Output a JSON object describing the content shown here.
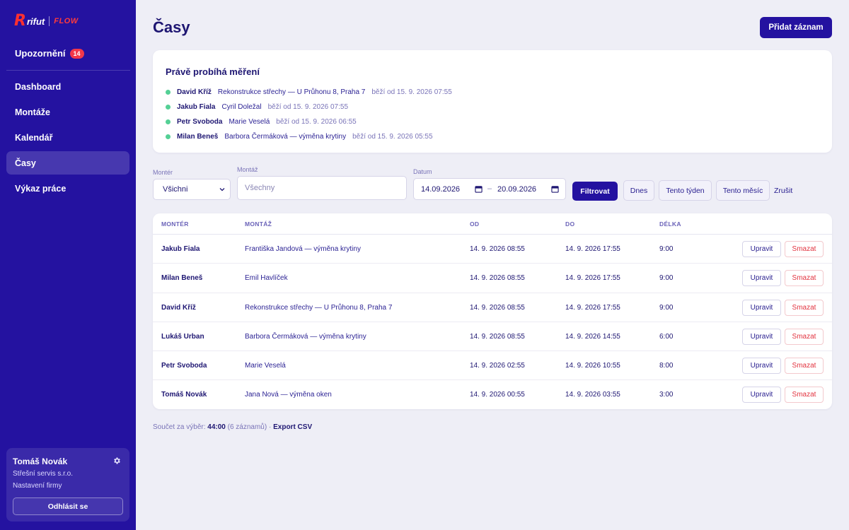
{
  "brand": {
    "logo_letter": "R",
    "logo_name": "rifut",
    "logo_product": "FLOW"
  },
  "sidebar": {
    "notifications_label": "Upozornění",
    "notifications_count": "14",
    "items": [
      {
        "label": "Dashboard",
        "active": false
      },
      {
        "label": "Montáže",
        "active": false
      },
      {
        "label": "Kalendář",
        "active": false
      },
      {
        "label": "Časy",
        "active": true
      },
      {
        "label": "Výkaz práce",
        "active": false
      }
    ],
    "user": {
      "name": "Tomáš Novák",
      "company": "Střešní servis s.r.o.",
      "settings_label": "Nastavení firmy",
      "logout_label": "Odhlásit se"
    }
  },
  "header": {
    "title": "Časy",
    "add_button": "Přidat záznam"
  },
  "running": {
    "title": "Právě probíhá měření",
    "items": [
      {
        "worker": "David Kříž",
        "job": "Rekonstrukce střechy — U Průhonu 8, Praha 7",
        "since": "běží od 15. 9. 2026 07:55"
      },
      {
        "worker": "Jakub Fiala",
        "job": "Cyril Doležal",
        "since": "běží od 15. 9. 2026 07:55"
      },
      {
        "worker": "Petr Svoboda",
        "job": "Marie Veselá",
        "since": "běží od 15. 9. 2026 06:55"
      },
      {
        "worker": "Milan Beneš",
        "job": "Barbora Čermáková — výměna krytiny",
        "since": "běží od 15. 9. 2026 05:55"
      }
    ]
  },
  "filters": {
    "worker_label": "Montér",
    "worker_value": "Všichni",
    "job_label": "Montáž",
    "job_placeholder": "Všechny",
    "date_label": "Datum",
    "date_from": "14.09.2026",
    "date_sep": "–",
    "date_to": "20.09.2026",
    "filter_button": "Filtrovat",
    "today_button": "Dnes",
    "week_button": "Tento týden",
    "month_button": "Tento měsíc",
    "reset_link": "Zrušit"
  },
  "table": {
    "headers": {
      "worker": "MONTÉR",
      "job": "MONTÁŽ",
      "from": "OD",
      "to": "DO",
      "duration": "DÉLKA"
    },
    "edit_label": "Upravit",
    "delete_label": "Smazat",
    "rows": [
      {
        "worker": "Jakub Fiala",
        "job": "Františka Jandová — výměna krytiny",
        "from": "14. 9. 2026 08:55",
        "to": "14. 9. 2026 17:55",
        "duration": "9:00"
      },
      {
        "worker": "Milan Beneš",
        "job": "Emil Havlíček",
        "from": "14. 9. 2026 08:55",
        "to": "14. 9. 2026 17:55",
        "duration": "9:00"
      },
      {
        "worker": "David Kříž",
        "job": "Rekonstrukce střechy — U Průhonu 8, Praha 7",
        "from": "14. 9. 2026 08:55",
        "to": "14. 9. 2026 17:55",
        "duration": "9:00"
      },
      {
        "worker": "Lukáš Urban",
        "job": "Barbora Čermáková — výměna krytiny",
        "from": "14. 9. 2026 08:55",
        "to": "14. 9. 2026 14:55",
        "duration": "6:00"
      },
      {
        "worker": "Petr Svoboda",
        "job": "Marie Veselá",
        "from": "14. 9. 2026 02:55",
        "to": "14. 9. 2026 10:55",
        "duration": "8:00"
      },
      {
        "worker": "Tomáš Novák",
        "job": "Jana Nová — výměna oken",
        "from": "14. 9. 2026 00:55",
        "to": "14. 9. 2026 03:55",
        "duration": "3:00"
      }
    ]
  },
  "summary": {
    "prefix": "Součet za výběr:",
    "total": "44:00",
    "count": "(6 záznamů)",
    "separator": "·",
    "export_link": "Export CSV"
  },
  "colors": {
    "sidebar": "#2412a0",
    "accent": "#2412a0",
    "running_dot": "#54d095",
    "danger": "#e2333f",
    "badge": "#f2384a"
  }
}
